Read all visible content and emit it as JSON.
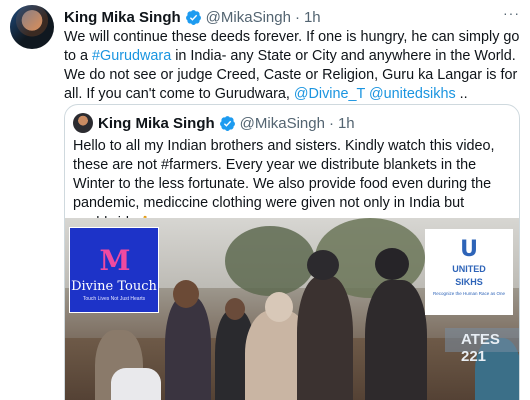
{
  "tweet": {
    "author_name": "King Mika Singh",
    "handle": "@MikaSingh",
    "separator": "·",
    "time": "1h",
    "more_label": "···",
    "text_segments": [
      {
        "text": "We will continue these deeds forever. If one is hungry, he can simply go to a ",
        "link": false
      },
      {
        "text": "#Gurudwara",
        "link": true
      },
      {
        "text": " in India- any State or City and anywhere in the World. We do not see or judge Creed, Caste or Religion, Guru ka Langar is for all. If you can't come to Gurudwara,  ",
        "link": false
      },
      {
        "text": "@Divine_T",
        "link": true
      },
      {
        "text": " ",
        "link": false
      },
      {
        "text": "@unitedsikhs",
        "link": true
      },
      {
        "text": " ..",
        "link": false
      }
    ]
  },
  "quoted_tweet": {
    "author_name": "King Mika Singh",
    "handle": "@MikaSingh",
    "separator": "·",
    "time": "1h",
    "text": "Hello to all my Indian brothers and sisters. Kindly watch this video, these are not #farmers. Every year we distribute blankets in the Winter to the less fortunate. We also provide food even during the pandemic, mediccine clothing were given not only in India but worldwide",
    "emoji": "🙏"
  },
  "video": {
    "logo_left": {
      "mark": "M",
      "name": "Divine Touch",
      "tagline": "Touch Lives Not Just Hearts"
    },
    "logo_right": {
      "mark": "U",
      "name_line1": "UNITED",
      "name_line2": "SIKHS",
      "tagline": "Recognize the Human Race as One"
    },
    "sign_text": "ATES 221"
  },
  "colors": {
    "link": "#1b95e0",
    "verified": "#1d9bf0",
    "muted": "#536471"
  }
}
